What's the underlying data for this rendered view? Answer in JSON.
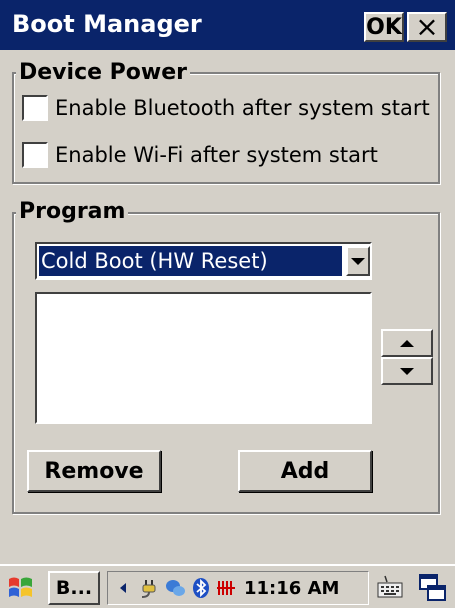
{
  "window": {
    "title": "Boot Manager",
    "ok_label": "OK",
    "close_label": "×"
  },
  "device_power": {
    "legend": "Device Power",
    "options": [
      {
        "label": "Enable Bluetooth after system start",
        "checked": false
      },
      {
        "label": "Enable Wi-Fi after system start",
        "checked": false
      }
    ]
  },
  "program": {
    "legend": "Program",
    "selected": "Cold Boot (HW Reset)",
    "list_items": [],
    "remove_label": "Remove",
    "add_label": "Add"
  },
  "taskbar": {
    "task_label": "B...",
    "clock": "11:16 AM",
    "icons": [
      "start-flag-icon",
      "tray-arrow-icon",
      "power-plug-icon",
      "network-icon",
      "bluetooth-icon",
      "signal-bars-icon",
      "keyboard-icon",
      "task-switch-icon"
    ]
  },
  "colors": {
    "titlebar": "#0a246a",
    "face": "#d4d0c8",
    "selection": "#0a246a"
  }
}
